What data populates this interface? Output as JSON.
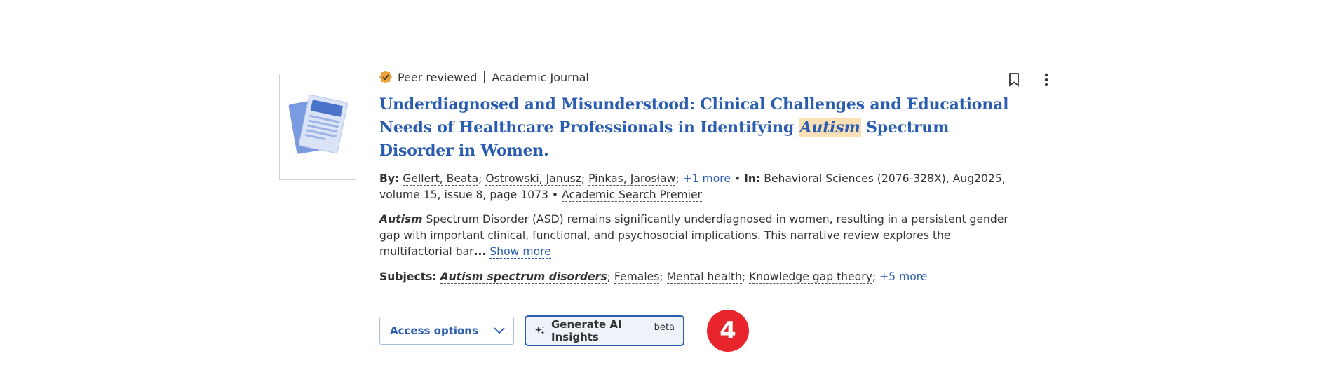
{
  "meta": {
    "peer_reviewed": "Peer reviewed",
    "type": "Academic Journal"
  },
  "title": {
    "part1": "Underdiagnosed and Misunderstood: Clinical Challenges and Educational Needs of Healthcare Professionals in Identifying ",
    "highlight": "Autism",
    "part2": " Spectrum Disorder in Women."
  },
  "byline": {
    "by_label": "By:",
    "authors": [
      "Gellert, Beata",
      "Ostrowski, Janusz",
      "Pinkas, Jarosław"
    ],
    "more_authors": "+1 more",
    "in_label": "In:",
    "source": "Behavioral Sciences (2076-328X), Aug2025, volume 15, issue 8, page 1073",
    "database": "Academic Search Premier"
  },
  "abstract": {
    "highlight": "Autism",
    "text": " Spectrum Disorder (ASD) remains significantly underdiagnosed in women, resulting in a persistent gender gap with important clinical, functional, and psychosocial implications. This narrative review explores the multifactorial bar",
    "ellipsis": "...",
    "show_more": "Show more"
  },
  "subjects": {
    "label": "Subjects:",
    "items": [
      "Autism spectrum disorders",
      "Females",
      "Mental health",
      "Knowledge gap theory"
    ],
    "more": "+5 more"
  },
  "buttons": {
    "access": "Access options",
    "ai": "Generate AI Insights",
    "ai_beta": "beta"
  },
  "badge": "4",
  "icons": {
    "peer_check": "check-badge-icon",
    "bookmark": "bookmark-icon",
    "more": "more-vertical-icon",
    "chevron": "chevron-down-icon",
    "sparkle": "sparkle-icon",
    "thumb": "document-icon"
  },
  "colors": {
    "link": "#2a5db0",
    "highlight": "#fbe0b6",
    "check": "#f0a23a",
    "badge": "#e8252b"
  }
}
